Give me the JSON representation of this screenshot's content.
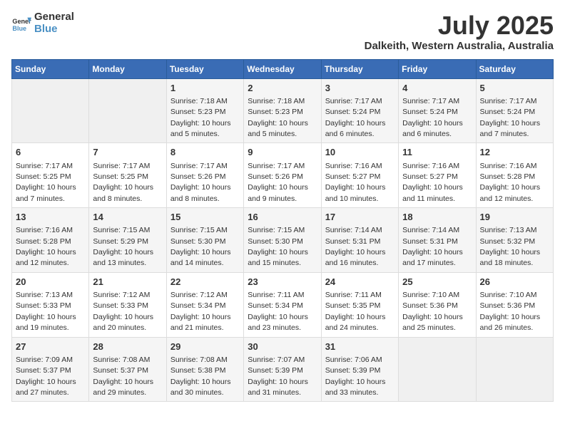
{
  "logo": {
    "line1": "General",
    "line2": "Blue"
  },
  "title": "July 2025",
  "location": "Dalkeith, Western Australia, Australia",
  "headers": [
    "Sunday",
    "Monday",
    "Tuesday",
    "Wednesday",
    "Thursday",
    "Friday",
    "Saturday"
  ],
  "weeks": [
    [
      {
        "day": "",
        "empty": true
      },
      {
        "day": "",
        "empty": true
      },
      {
        "day": "1",
        "sunrise": "7:18 AM",
        "sunset": "5:23 PM",
        "daylight": "10 hours and 5 minutes."
      },
      {
        "day": "2",
        "sunrise": "7:18 AM",
        "sunset": "5:23 PM",
        "daylight": "10 hours and 5 minutes."
      },
      {
        "day": "3",
        "sunrise": "7:17 AM",
        "sunset": "5:24 PM",
        "daylight": "10 hours and 6 minutes."
      },
      {
        "day": "4",
        "sunrise": "7:17 AM",
        "sunset": "5:24 PM",
        "daylight": "10 hours and 6 minutes."
      },
      {
        "day": "5",
        "sunrise": "7:17 AM",
        "sunset": "5:24 PM",
        "daylight": "10 hours and 7 minutes."
      }
    ],
    [
      {
        "day": "6",
        "sunrise": "7:17 AM",
        "sunset": "5:25 PM",
        "daylight": "10 hours and 7 minutes."
      },
      {
        "day": "7",
        "sunrise": "7:17 AM",
        "sunset": "5:25 PM",
        "daylight": "10 hours and 8 minutes."
      },
      {
        "day": "8",
        "sunrise": "7:17 AM",
        "sunset": "5:26 PM",
        "daylight": "10 hours and 8 minutes."
      },
      {
        "day": "9",
        "sunrise": "7:17 AM",
        "sunset": "5:26 PM",
        "daylight": "10 hours and 9 minutes."
      },
      {
        "day": "10",
        "sunrise": "7:16 AM",
        "sunset": "5:27 PM",
        "daylight": "10 hours and 10 minutes."
      },
      {
        "day": "11",
        "sunrise": "7:16 AM",
        "sunset": "5:27 PM",
        "daylight": "10 hours and 11 minutes."
      },
      {
        "day": "12",
        "sunrise": "7:16 AM",
        "sunset": "5:28 PM",
        "daylight": "10 hours and 12 minutes."
      }
    ],
    [
      {
        "day": "13",
        "sunrise": "7:16 AM",
        "sunset": "5:28 PM",
        "daylight": "10 hours and 12 minutes."
      },
      {
        "day": "14",
        "sunrise": "7:15 AM",
        "sunset": "5:29 PM",
        "daylight": "10 hours and 13 minutes."
      },
      {
        "day": "15",
        "sunrise": "7:15 AM",
        "sunset": "5:30 PM",
        "daylight": "10 hours and 14 minutes."
      },
      {
        "day": "16",
        "sunrise": "7:15 AM",
        "sunset": "5:30 PM",
        "daylight": "10 hours and 15 minutes."
      },
      {
        "day": "17",
        "sunrise": "7:14 AM",
        "sunset": "5:31 PM",
        "daylight": "10 hours and 16 minutes."
      },
      {
        "day": "18",
        "sunrise": "7:14 AM",
        "sunset": "5:31 PM",
        "daylight": "10 hours and 17 minutes."
      },
      {
        "day": "19",
        "sunrise": "7:13 AM",
        "sunset": "5:32 PM",
        "daylight": "10 hours and 18 minutes."
      }
    ],
    [
      {
        "day": "20",
        "sunrise": "7:13 AM",
        "sunset": "5:33 PM",
        "daylight": "10 hours and 19 minutes."
      },
      {
        "day": "21",
        "sunrise": "7:12 AM",
        "sunset": "5:33 PM",
        "daylight": "10 hours and 20 minutes."
      },
      {
        "day": "22",
        "sunrise": "7:12 AM",
        "sunset": "5:34 PM",
        "daylight": "10 hours and 21 minutes."
      },
      {
        "day": "23",
        "sunrise": "7:11 AM",
        "sunset": "5:34 PM",
        "daylight": "10 hours and 23 minutes."
      },
      {
        "day": "24",
        "sunrise": "7:11 AM",
        "sunset": "5:35 PM",
        "daylight": "10 hours and 24 minutes."
      },
      {
        "day": "25",
        "sunrise": "7:10 AM",
        "sunset": "5:36 PM",
        "daylight": "10 hours and 25 minutes."
      },
      {
        "day": "26",
        "sunrise": "7:10 AM",
        "sunset": "5:36 PM",
        "daylight": "10 hours and 26 minutes."
      }
    ],
    [
      {
        "day": "27",
        "sunrise": "7:09 AM",
        "sunset": "5:37 PM",
        "daylight": "10 hours and 27 minutes."
      },
      {
        "day": "28",
        "sunrise": "7:08 AM",
        "sunset": "5:37 PM",
        "daylight": "10 hours and 29 minutes."
      },
      {
        "day": "29",
        "sunrise": "7:08 AM",
        "sunset": "5:38 PM",
        "daylight": "10 hours and 30 minutes."
      },
      {
        "day": "30",
        "sunrise": "7:07 AM",
        "sunset": "5:39 PM",
        "daylight": "10 hours and 31 minutes."
      },
      {
        "day": "31",
        "sunrise": "7:06 AM",
        "sunset": "5:39 PM",
        "daylight": "10 hours and 33 minutes."
      },
      {
        "day": "",
        "empty": true
      },
      {
        "day": "",
        "empty": true
      }
    ]
  ]
}
